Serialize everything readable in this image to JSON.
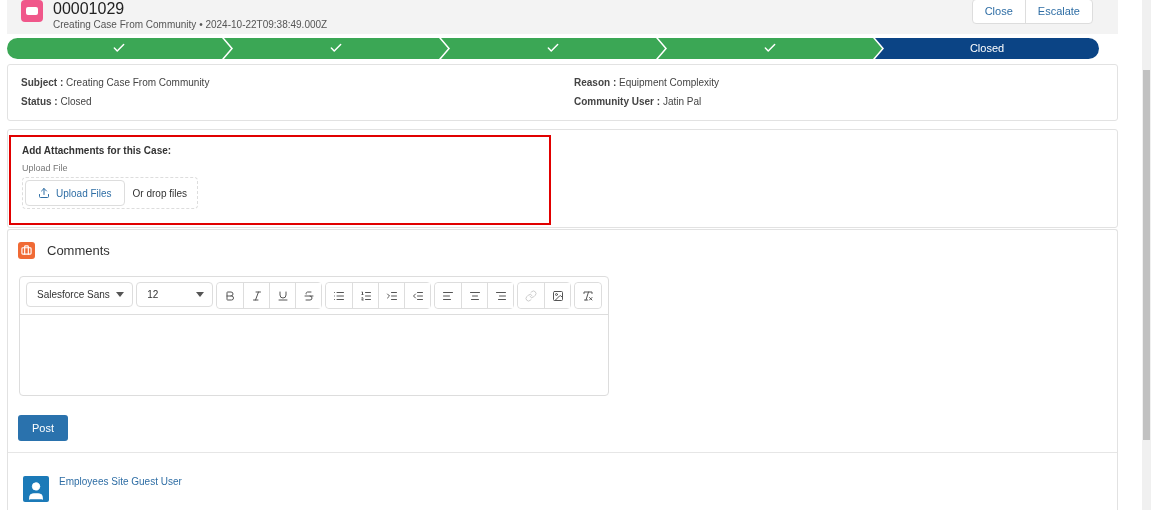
{
  "header": {
    "title": "00001029",
    "subtitle": "Creating Case From Community • 2024-10-22T09:38:49.000Z",
    "actions": [
      "Close",
      "Escalate"
    ]
  },
  "path": [
    {
      "selected": false
    },
    {
      "selected": false
    },
    {
      "selected": false
    },
    {
      "selected": false
    },
    {
      "selected": true,
      "label": "Closed"
    }
  ],
  "details": {
    "left": [
      {
        "label": "Subject :",
        "value": "Creating Case From Community"
      },
      {
        "label": "Status :",
        "value": "Closed"
      }
    ],
    "right": [
      {
        "label": "Reason :",
        "value": "Equipment Complexity"
      },
      {
        "label": "Community User :",
        "value": "Jatin Pal"
      }
    ]
  },
  "attachments": {
    "highlighted": true,
    "heading": "Add Attachments for this Case:",
    "upload_label": "Upload File",
    "button": "Upload Files",
    "drop_text": "Or drop files"
  },
  "comments": {
    "title": "Comments",
    "font": "Salesforce Sans",
    "size": "12",
    "toolbar_groups": [
      [
        {
          "disabled": false
        },
        {
          "disabled": false
        },
        {
          "disabled": false
        },
        {
          "disabled": false
        }
      ],
      [
        {
          "disabled": false
        },
        {
          "disabled": false
        },
        {
          "disabled": false
        },
        {
          "disabled": false
        }
      ],
      [
        {
          "disabled": false
        },
        {
          "disabled": false
        },
        {
          "disabled": false
        }
      ],
      [
        {
          "disabled": true
        },
        {
          "disabled": false
        }
      ],
      [
        {
          "disabled": false
        }
      ]
    ],
    "post_button": "Post"
  },
  "feed": [
    {
      "author": "Employees Site Guest User"
    }
  ]
}
